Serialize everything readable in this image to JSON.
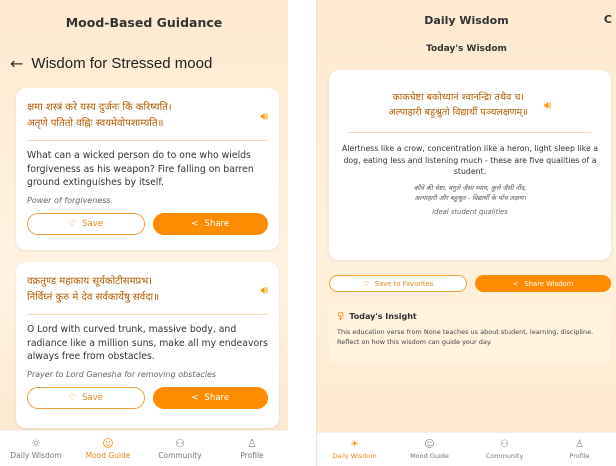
{
  "left": {
    "header_title": "Mood-Based Guidance",
    "page_title": "Wisdom for Stressed mood",
    "cards": [
      {
        "sanskrit_line1": "क्षमा शस्त्रं करे यस्य दुर्जनः किं करिष्यति।",
        "sanskrit_line2": "अतृणे पतितो वह्निः स्वयमेवोपशाम्यति॥",
        "meaning": "What can a wicked person do to one who wields forgiveness as his weapon? Fire falling on barren ground extinguishes by itself.",
        "context": "Power of forgiveness",
        "save_label": "Save",
        "share_label": "Share"
      },
      {
        "sanskrit_line1": "वक्रतुण्ड महाकाय सूर्यकोटीसमप्रभ।",
        "sanskrit_line2": "निर्विघ्नं कुरु मे देव सर्वकार्येषु सर्वदा॥",
        "meaning": "O Lord with curved trunk, massive body, and radiance like a million suns, make all my endeavors always free from obstacles.",
        "context": "Prayer to Lord Ganesha for removing obstacles",
        "save_label": "Save",
        "share_label": "Share"
      }
    ],
    "nav": [
      {
        "label": "Daily Wisdom",
        "icon": "sun-icon"
      },
      {
        "label": "Mood Guide",
        "icon": "smile-icon"
      },
      {
        "label": "Community",
        "icon": "people-icon"
      },
      {
        "label": "Profile",
        "icon": "person-icon"
      }
    ]
  },
  "right": {
    "header_title": "Daily Wisdom",
    "subtitle": "Today's Wisdom",
    "sanskrit_line1": "काकचेष्टा बकोध्यानं श्वानन्द्रिा तथैव च।",
    "sanskrit_line2": "अल्पाहारी बहुश्रुतो विद्यार्थी पञ्चलक्षणम्॥",
    "meaning": "Alertness like a crow, concentration like a heron, light sleep like a dog, eating less and listening much - these are five qualities of a student.",
    "hindi_line1": "कौवे की चेष्टा, बगुले जैसा ध्यान, कुत्ते जैसी नींद,",
    "hindi_line2": "अल्पाहारी और बहुश्रुत - विद्यार्थी के पाँच लक्षण।",
    "context": "Ideal student qualities",
    "save_label": "Save to Favorites",
    "share_label": "Share Wisdom",
    "insight_title": "Today's Insight",
    "insight_text": "This education verse from None teaches us about student, learning, discipline. Reflect on how this wisdom can guide your day.",
    "nav": [
      {
        "label": "Daily Wisdom",
        "icon": "sun-icon"
      },
      {
        "label": "Mood Guide",
        "icon": "smile-icon"
      },
      {
        "label": "Community",
        "icon": "people-icon"
      },
      {
        "label": "Profile",
        "icon": "person-icon"
      }
    ]
  },
  "colors": {
    "accent": "#ff8c00",
    "sanskrit": "#b35a00",
    "background": "#fde9cf"
  }
}
